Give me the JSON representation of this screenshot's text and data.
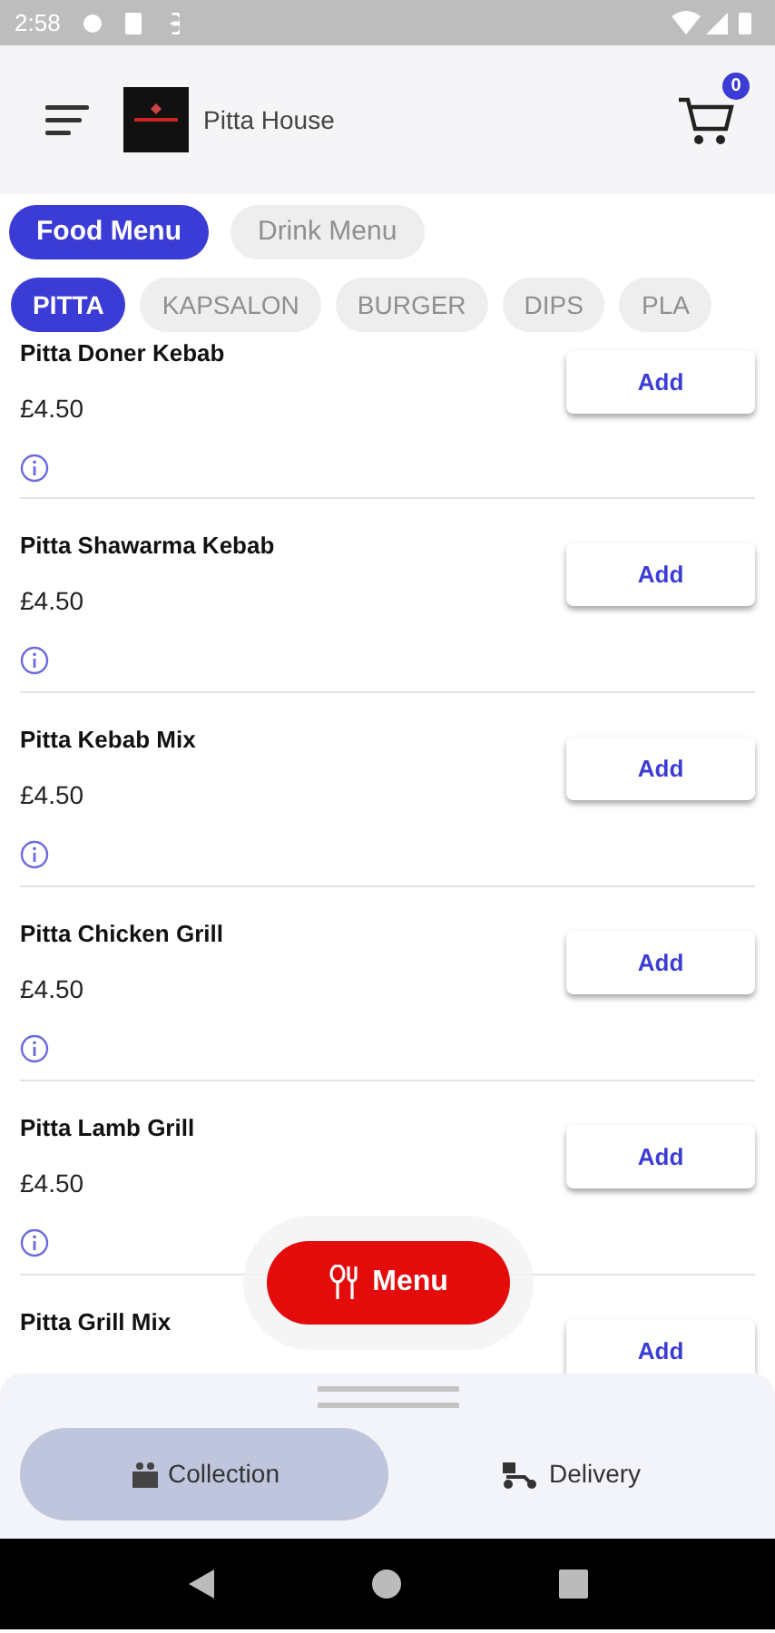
{
  "status_bar": {
    "time": "2:58"
  },
  "header": {
    "title": "Pitta House",
    "cart_count": "0"
  },
  "menu_tabs": [
    {
      "label": "Food Menu",
      "selected": true
    },
    {
      "label": "Drink Menu",
      "selected": false
    }
  ],
  "categories": [
    {
      "label": "PITTA",
      "selected": true
    },
    {
      "label": "KAPSALON",
      "selected": false
    },
    {
      "label": "BURGER",
      "selected": false
    },
    {
      "label": "DIPS",
      "selected": false
    },
    {
      "label": "PLA",
      "selected": false
    }
  ],
  "items": [
    {
      "name": "Pitta Doner Kebab",
      "price": "£4.50",
      "button": "Add"
    },
    {
      "name": "Pitta Shawarma Kebab",
      "price": "£4.50",
      "button": "Add"
    },
    {
      "name": "Pitta Kebab Mix",
      "price": "£4.50",
      "button": "Add"
    },
    {
      "name": "Pitta Chicken Grill",
      "price": "£4.50",
      "button": "Add"
    },
    {
      "name": "Pitta Lamb Grill",
      "price": "£4.50",
      "button": "Add"
    },
    {
      "name": "Pitta Grill Mix",
      "button": "Add"
    }
  ],
  "menu_button": {
    "label": "Menu"
  },
  "order_types": [
    {
      "label": "Collection",
      "selected": true,
      "kind": "collection"
    },
    {
      "label": "Delivery",
      "selected": false,
      "kind": "delivery"
    }
  ]
}
